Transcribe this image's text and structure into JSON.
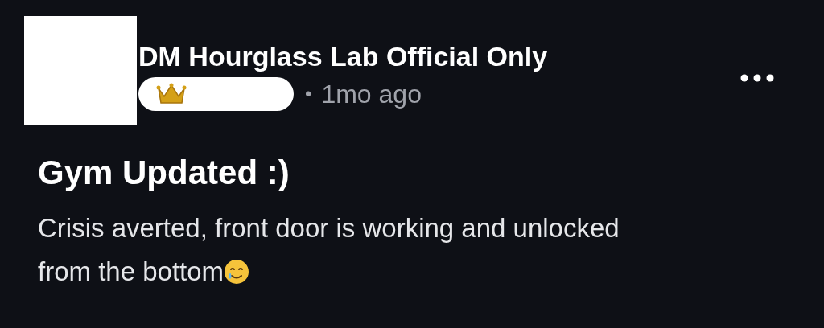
{
  "post": {
    "author": "DM Hourglass Lab Official Only",
    "separator": "•",
    "time": "1mo ago",
    "title": "Gym Updated :)",
    "body_lines": [
      "Crisis averted, front door is working and unlocked",
      "from the bottom"
    ]
  }
}
